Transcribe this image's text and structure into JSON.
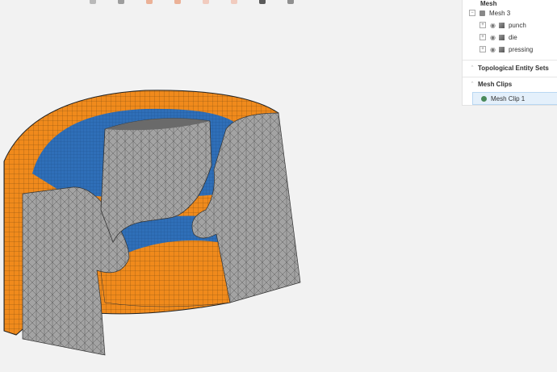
{
  "toolbar": {
    "icons": [
      "view-front-icon",
      "view-iso-icon",
      "clip-x-icon",
      "clip-y-icon",
      "clip-z-icon",
      "clip-plane-icon",
      "pointer-select-icon",
      "settings-icon"
    ]
  },
  "panel": {
    "header_cut": "Mesh",
    "mesh": {
      "label": "Mesh 3",
      "children": [
        {
          "label": "punch"
        },
        {
          "label": "die"
        },
        {
          "label": "pressing"
        }
      ]
    },
    "topological": "Topological Entity Sets",
    "clips_section": "Mesh Clips",
    "clip_item": "Mesh Clip 1"
  },
  "colors": {
    "orange": "#f08a1c",
    "blue": "#2f6fb8",
    "mesh_gray": "#9a9a9a",
    "selection": "#e4f0fb"
  }
}
